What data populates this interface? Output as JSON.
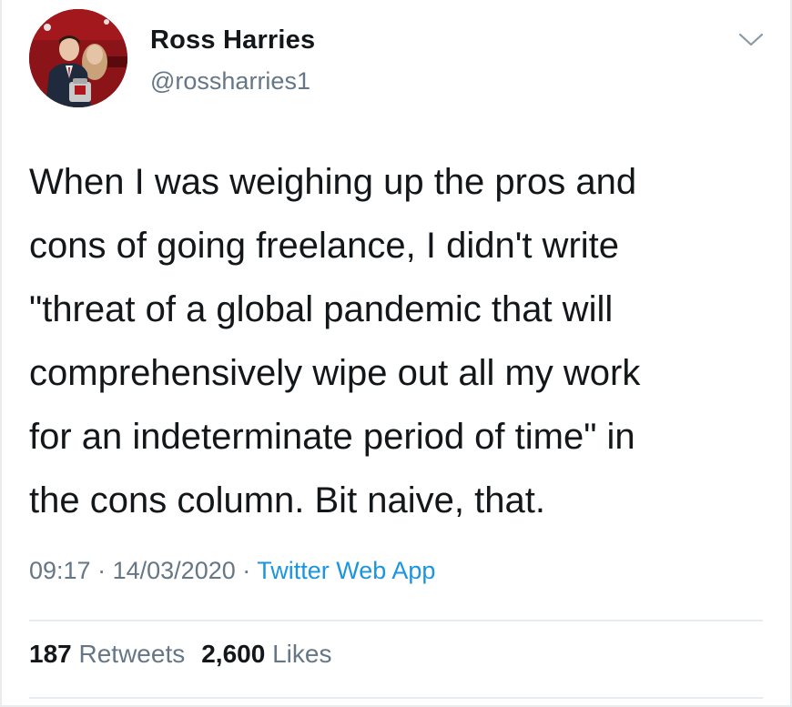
{
  "author": {
    "display_name": "Ross Harries",
    "handle": "@rossharries1",
    "avatar_icon": "profile-photo"
  },
  "tweet": {
    "text_lines": [
      "When I was weighing up the pros and",
      "cons of going freelance, I didn't write",
      "\"threat of a global pandemic that will",
      "comprehensively wipe out all my work",
      "for an indeterminate period of time\" in",
      "the cons column. Bit naive, that."
    ],
    "time": "09:17",
    "date": "14/03/2020",
    "separator": "·",
    "source": "Twitter Web App"
  },
  "stats": {
    "retweets_count": "187",
    "retweets_label": "Retweets",
    "likes_count": "2,600",
    "likes_label": "Likes"
  },
  "menu": {
    "icon": "chevron-down-icon"
  },
  "colors": {
    "text": "#14171a",
    "secondary": "#657786",
    "link": "#1b95e0",
    "divider": "#e6ecf0"
  }
}
